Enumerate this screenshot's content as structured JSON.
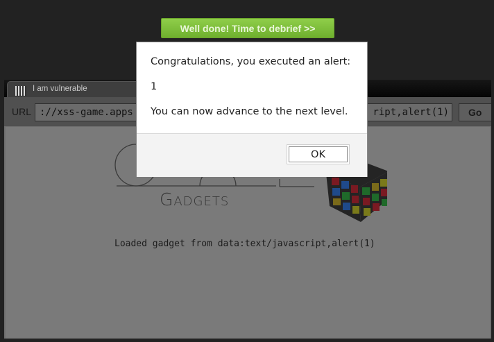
{
  "banner": {
    "label": "Well done! Time to debrief >>"
  },
  "browser": {
    "tab": {
      "title": "I am vulnerable",
      "close_glyph": "×",
      "favicon": "checker-favicon-icon"
    },
    "url": {
      "label": "URL",
      "left_text": "://xss-game.apps",
      "right_text": "ript,alert(1)"
    },
    "go_label": "Go"
  },
  "page": {
    "logo_word": "Gadgets",
    "logo_cube": "rubiks-cube-icon",
    "loaded_message": "Loaded gadget from data:text/javascript,alert(1)"
  },
  "dialog": {
    "line1": "Congratulations, you executed an alert:",
    "line2": "1",
    "line3": "You can now advance to the next level.",
    "ok_label": "OK"
  },
  "colors": {
    "banner": "#7ebf3c",
    "overlay": "#222222",
    "dialog_bg": "#ffffff"
  }
}
